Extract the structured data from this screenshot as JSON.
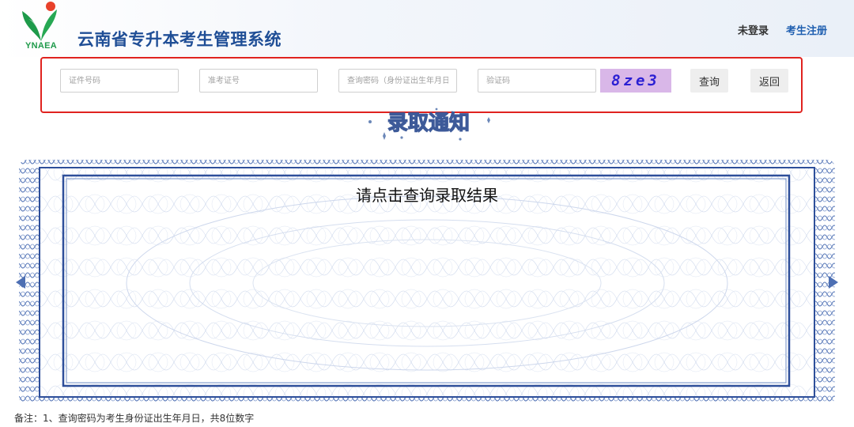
{
  "header": {
    "logo_text": "YNAEA",
    "title": "云南省专升本考生管理系统",
    "links": {
      "login": "未登录",
      "register": "考生注册"
    }
  },
  "query": {
    "id_number": {
      "placeholder": "证件号码",
      "value": ""
    },
    "exam_number": {
      "placeholder": "准考证号",
      "value": ""
    },
    "password": {
      "placeholder": "查询密码（身份证出生年月日）",
      "value": ""
    },
    "captcha_input": {
      "placeholder": "验证码",
      "value": ""
    },
    "captcha_code": "8ze3",
    "search_label": "查询",
    "back_label": "返回"
  },
  "certificate": {
    "heading": "录取通知",
    "result_prompt": "请点击查询录取结果"
  },
  "footnote": "备注：1、查询密码为考生身份证出生年月日，共8位数字",
  "colors": {
    "title_blue": "#1f4e96",
    "highlight_red": "#e0231f",
    "captcha_bg": "#d9b7e8",
    "captcha_text": "#2b1fd3",
    "border_blue": "#2e4f9a"
  }
}
